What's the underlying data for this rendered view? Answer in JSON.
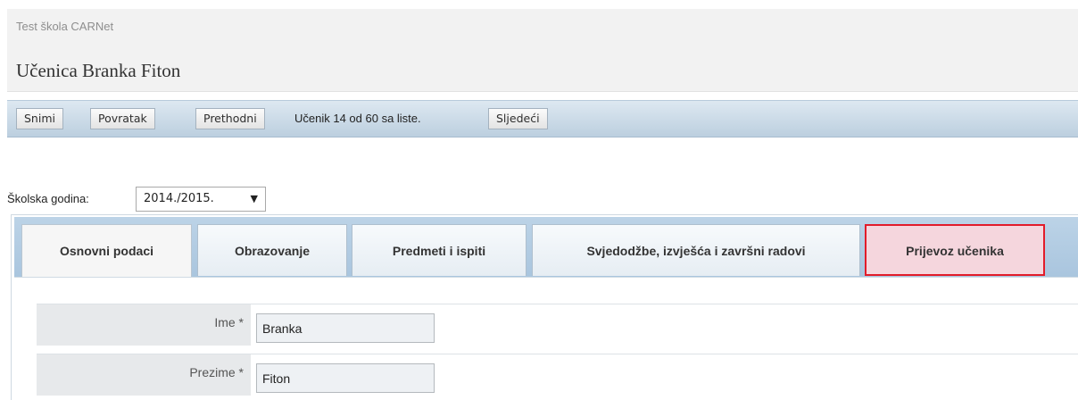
{
  "header": {
    "school": "Test škola CARNet",
    "title": "Učenica Branka Fiton"
  },
  "toolbar": {
    "save_label": "Snimi",
    "back_label": "Povratak",
    "prev_label": "Prethodni",
    "position_info": "Učenik 14 od 60 sa liste.",
    "next_label": "Sljedeći"
  },
  "school_year": {
    "label": "Školska godina:",
    "selected": "2014./2015.",
    "arrow": "▼"
  },
  "tabs": [
    {
      "label": "Osnovni podaci"
    },
    {
      "label": "Obrazovanje"
    },
    {
      "label": "Predmeti i ispiti"
    },
    {
      "label": "Svjedodžbe, izvješća i završni radovi"
    },
    {
      "label": "Prijevoz učenika"
    }
  ],
  "form": {
    "first_name": {
      "label": "Ime *",
      "value": "Branka"
    },
    "last_name": {
      "label": "Prezime *",
      "value": "Fiton"
    }
  }
}
